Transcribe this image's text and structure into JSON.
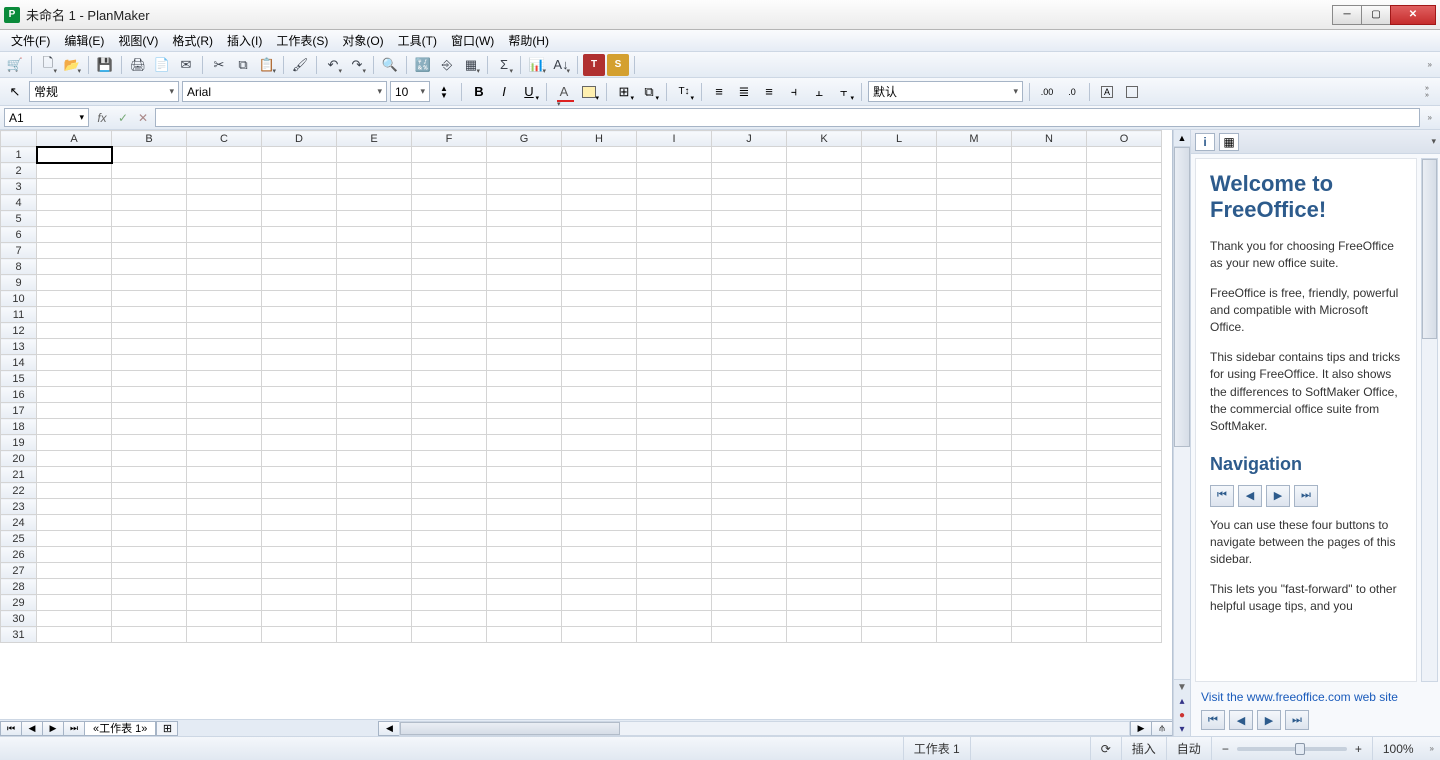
{
  "window": {
    "title": "未命名 1 - PlanMaker"
  },
  "menubar": [
    "文件(F)",
    "编辑(E)",
    "视图(V)",
    "格式(R)",
    "插入(I)",
    "工作表(S)",
    "对象(O)",
    "工具(T)",
    "窗口(W)",
    "帮助(H)"
  ],
  "format": {
    "style": "常规",
    "font": "Arial",
    "size": "10",
    "lang": "默认"
  },
  "formula": {
    "cell_ref": "A1",
    "input": ""
  },
  "grid": {
    "columns": [
      "A",
      "B",
      "C",
      "D",
      "E",
      "F",
      "G",
      "H",
      "I",
      "J",
      "K",
      "L",
      "M",
      "N",
      "O"
    ],
    "rows": 31,
    "selected": "A1"
  },
  "tabs": {
    "items": [
      "«工作表 1»"
    ]
  },
  "sidebar": {
    "title": "Welcome to FreeOffice!",
    "p1": "Thank you for choosing FreeOffice as your new office suite.",
    "p2": "FreeOffice is free, friendly, powerful and compatible with Microsoft Office.",
    "p3": "This sidebar contains tips and tricks for using FreeOffice. It also shows the differences to SoftMaker Office, the commercial office suite from SoftMaker.",
    "nav_heading": "Navigation",
    "p4": "You can use these four buttons to navigate between the pages of this sidebar.",
    "p5": "This lets you \"fast-forward\" to other helpful usage tips, and you",
    "link": "Visit the www.freeoffice.com web site"
  },
  "status": {
    "sheet": "工作表 1",
    "insert": "插入",
    "auto": "自动",
    "zoom": "100%"
  }
}
